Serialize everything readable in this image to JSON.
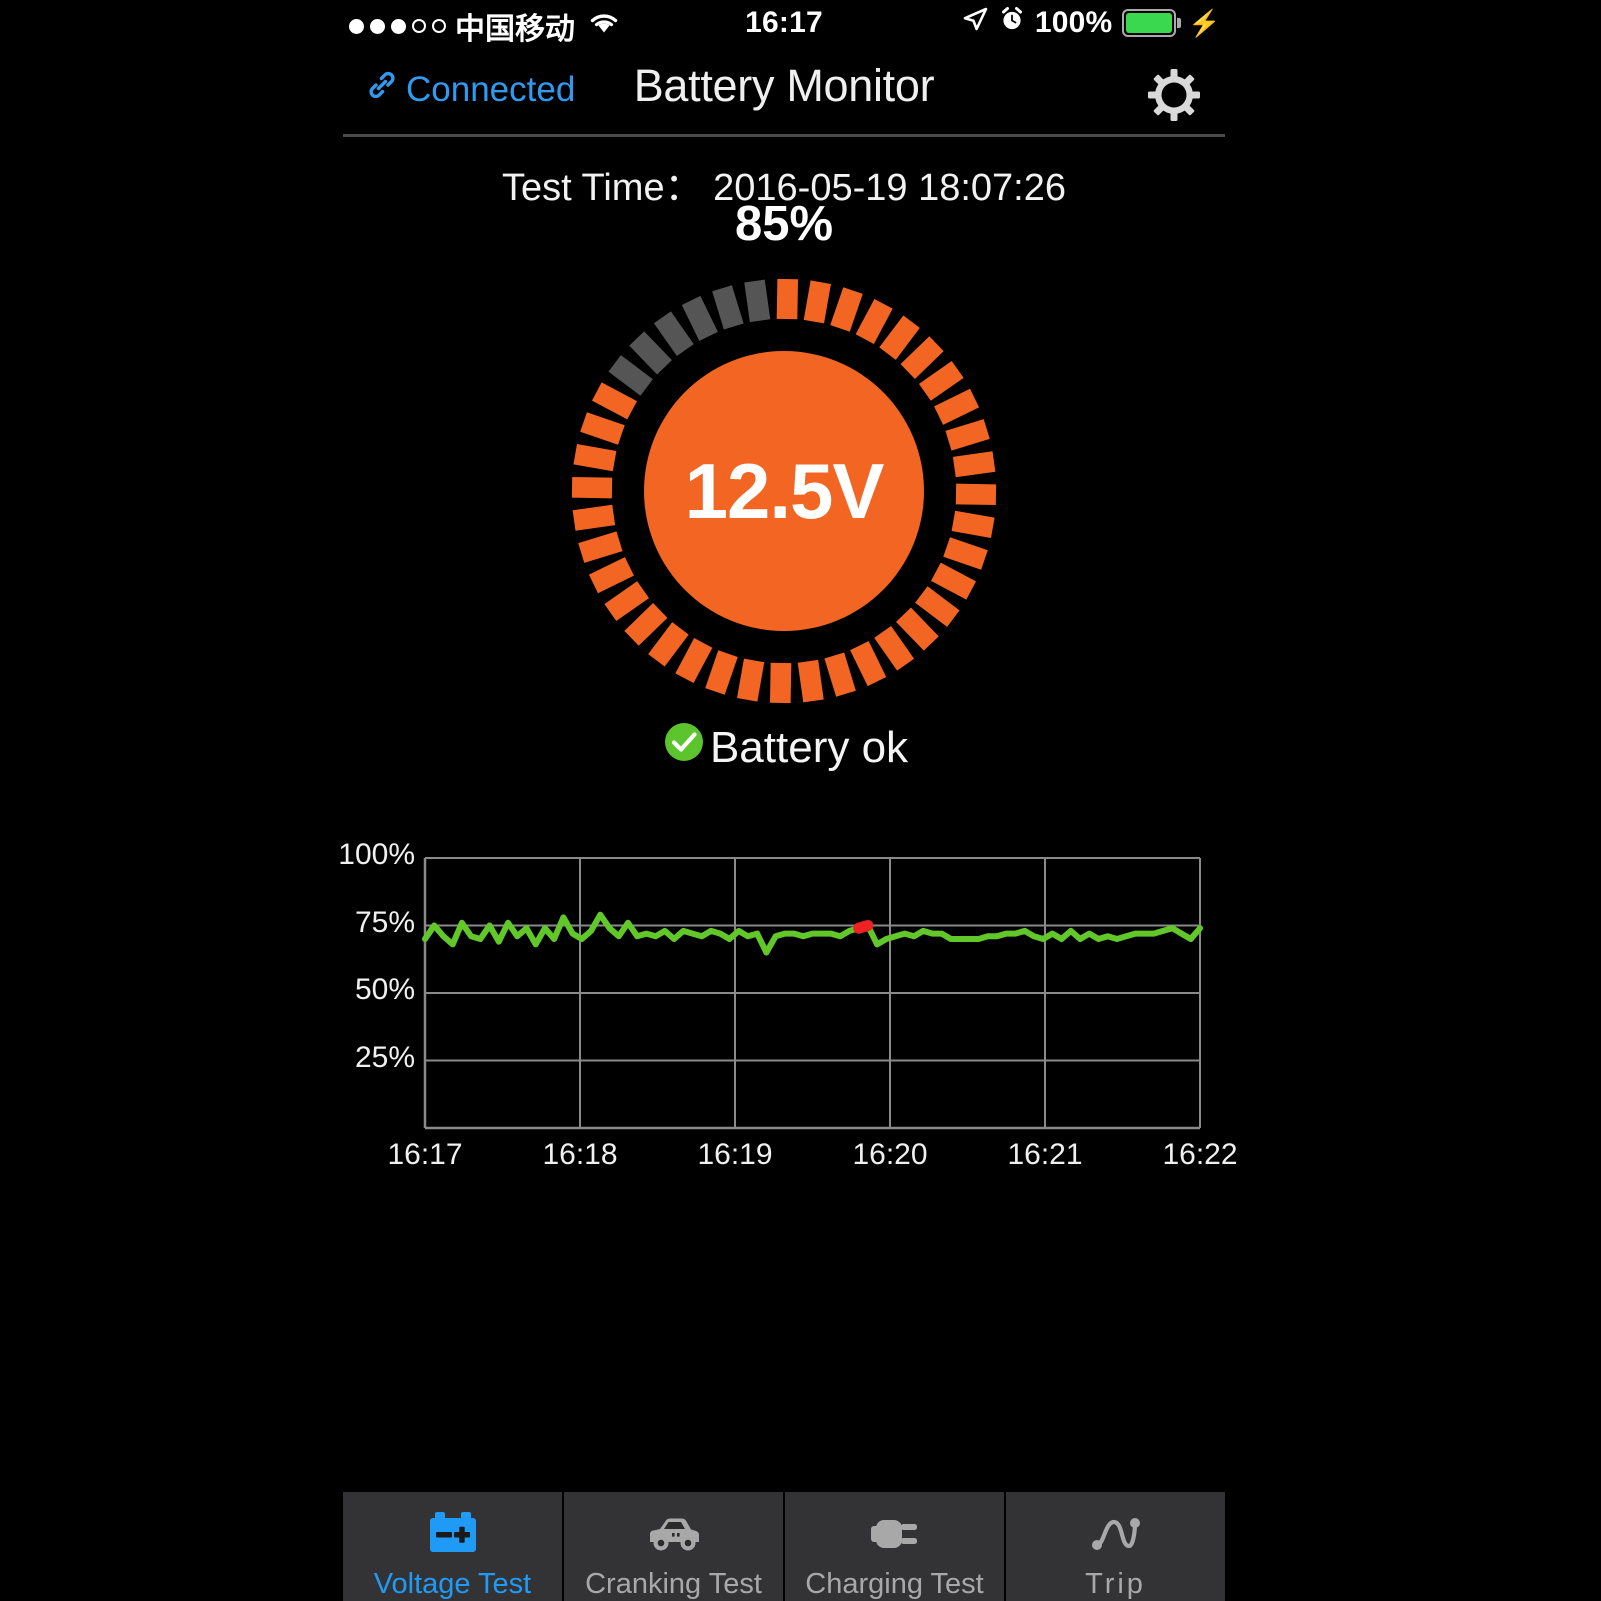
{
  "status_bar": {
    "signal_dots_filled": 3,
    "signal_dots_total": 5,
    "carrier": "中国移动",
    "wifi_icon": "wifi-icon",
    "time": "16:17",
    "location_icon": "location-arrow-icon",
    "alarm_icon": "alarm-clock-icon",
    "battery_percent": "100%",
    "battery_color": "#3ad84e",
    "charging_icon": "lightning-bolt-icon"
  },
  "nav_bar": {
    "connection_icon": "link-icon",
    "connection_label": "Connected",
    "connection_color": "#2f9bf0",
    "title": "Battery Monitor",
    "settings_icon": "gear-icon"
  },
  "readout": {
    "test_time_label": "Test Time：",
    "test_time_value": "2016-05-19 18:07:26",
    "test_time_full": "Test Time： 2016-05-19 18:07:26",
    "charge_percent": "85%"
  },
  "gauge": {
    "voltage": "12.5V",
    "percent": 85,
    "segments_total": 40,
    "segments_filled": 34,
    "fill_color": "#f26522",
    "empty_color": "#555555",
    "hub_color": "#f26522",
    "text_color": "#ffffff"
  },
  "status": {
    "icon": "check-circle-icon",
    "icon_color": "#5cc42c",
    "label": "Battery ok"
  },
  "chart_data": {
    "type": "line",
    "title": "",
    "xlabel": "",
    "ylabel": "",
    "ylim": [
      0,
      100
    ],
    "ytick_labels": [
      "100%",
      "75%",
      "50%",
      "25%"
    ],
    "ytick_values": [
      100,
      75,
      50,
      25
    ],
    "xtick_labels": [
      "16:17",
      "16:18",
      "16:19",
      "16:20",
      "16:21",
      "16:22"
    ],
    "xlim": [
      "16:17",
      "16:22"
    ],
    "grid": true,
    "legend": "none",
    "line_color": "#62c829",
    "marker_color": "#ee2222",
    "marker_index": 48,
    "marker_value": 75,
    "axis_color": "#8a8a8a",
    "values": [
      70,
      75,
      71,
      68,
      76,
      71,
      70,
      75,
      69,
      76,
      71,
      74,
      68,
      74,
      70,
      78,
      72,
      70,
      73,
      79,
      74,
      71,
      76,
      71,
      72,
      71,
      73,
      70,
      73,
      72,
      71,
      73,
      72,
      70,
      73,
      71,
      72,
      65,
      71,
      72,
      72,
      71,
      72,
      72,
      72,
      71,
      73,
      74,
      75,
      68,
      70,
      71,
      72,
      71,
      73,
      72,
      72,
      70,
      70,
      70,
      70,
      71,
      71,
      72,
      72,
      73,
      71,
      70,
      72,
      70,
      73,
      70,
      72,
      70,
      71,
      70,
      71,
      72,
      72,
      72,
      73,
      74,
      72,
      70,
      74
    ]
  },
  "tabs": [
    {
      "id": "voltage-test",
      "label": "Voltage Test",
      "icon": "car-battery-icon",
      "active": true,
      "color": "#1f9bf5"
    },
    {
      "id": "cranking-test",
      "label": "Cranking Test",
      "icon": "car-icon",
      "active": false,
      "color": "#a8a8a8"
    },
    {
      "id": "charging-test",
      "label": "Charging Test",
      "icon": "power-plug-icon",
      "active": false,
      "color": "#a8a8a8"
    },
    {
      "id": "trip",
      "label": "Trip",
      "icon": "trip-curve-icon",
      "active": false,
      "color": "#a8a8a8"
    }
  ]
}
